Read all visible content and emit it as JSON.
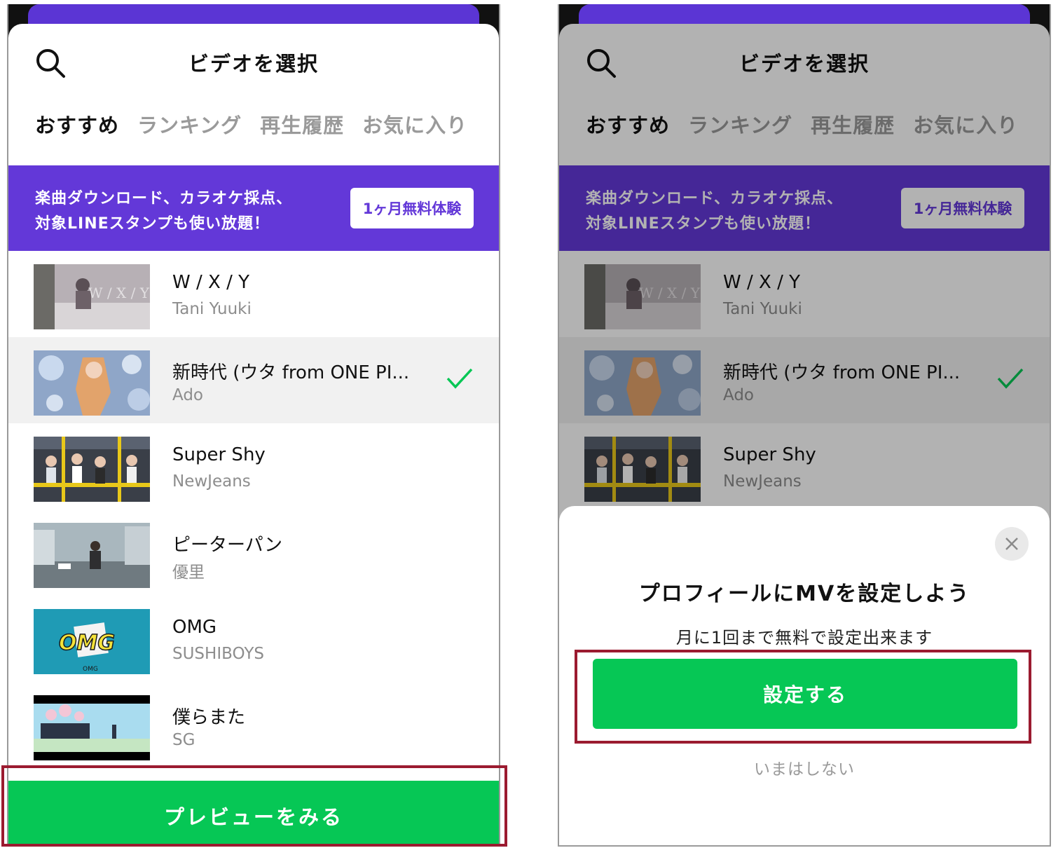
{
  "header": {
    "title": "ビデオを選択"
  },
  "tabs": [
    {
      "label": "おすすめ",
      "active": true
    },
    {
      "label": "ランキング",
      "active": false
    },
    {
      "label": "再生履歴",
      "active": false
    },
    {
      "label": "お気に入り",
      "active": false
    }
  ],
  "banner": {
    "line1": "楽曲ダウンロード、カラオケ採点、",
    "line2": "対象LINEスタンプも使い放題！",
    "button": "1ヶ月無料体験"
  },
  "songs": [
    {
      "title": "W / X / Y",
      "artist": "Tani Yuuki",
      "thumb_text": "W / X / Y",
      "selected": false
    },
    {
      "title": "新時代 (ウタ from ONE PI...",
      "artist": "Ado",
      "thumb_text": "",
      "selected": true
    },
    {
      "title": "Super Shy",
      "artist": "NewJeans",
      "thumb_text": "",
      "selected": false
    },
    {
      "title": "ピーターパン",
      "artist": "優里",
      "thumb_text": "",
      "selected": false
    },
    {
      "title": "OMG",
      "artist": "SUSHIBOYS",
      "thumb_text": "OMG",
      "selected": false
    },
    {
      "title": "僕らまた",
      "artist": "SG",
      "thumb_text": "",
      "selected": false
    }
  ],
  "preview_button": "プレビューをみる",
  "modal": {
    "title": "プロフィールにMVを設定しよう",
    "subtitle": "月に1回まで無料で設定出来ます",
    "set_button": "設定する",
    "not_now": "いまはしない"
  },
  "colors": {
    "accent_purple": "#6338d8",
    "line_green": "#06c755",
    "highlight_red": "#9b1b30"
  },
  "icons": [
    "search-icon",
    "check-icon",
    "close-icon"
  ]
}
